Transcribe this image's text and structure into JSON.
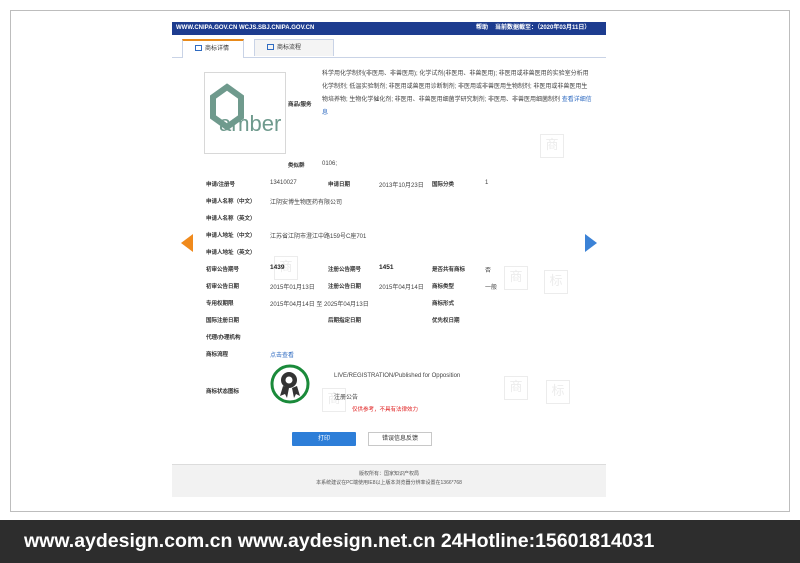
{
  "header": {
    "url": "WWW.CNIPA.GOV.CN WCJS.SBJ.CNIPA.GOV.CN",
    "help": "帮助",
    "date": "当前数据截至：（2020年03月11日）"
  },
  "tabs": [
    {
      "label": "商标详情"
    },
    {
      "label": "商标流程"
    }
  ],
  "logo": {
    "text": "amber",
    "color": "#6f9a8d"
  },
  "goods": {
    "label": "商品/服务",
    "text": "科学用化学制剂(非医用、非兽医用); 化学试剂(非医用、非兽医用); 非医用或非兽医用的实验室分析用化学制剂; 低温实验制剂; 非医用或兽医用诊断制剂; 非医用或非兽医用生物制剂; 非医用或非兽医用生物培养物; 生物化学催化剂; 非医用、非兽医用细菌学研究制剂; 非医用、非兽医用细菌制剂",
    "more": "查看详细信息"
  },
  "similar_group": {
    "label": "类似群",
    "value": "0106;"
  },
  "fields": {
    "reg_no_label": "申请/注册号",
    "reg_no": "13410027",
    "apply_date_label": "申请日期",
    "apply_date": "2013年10月23日",
    "intl_class_label": "国际分类",
    "intl_class": "1",
    "applicant_cn_label": "申请人名称（中文）",
    "applicant_cn": "江阴安博生物医药有限公司",
    "applicant_en_label": "申请人名称（英文）",
    "address_cn_label": "申请人地址（中文）",
    "address_cn": "江苏省江阴市澄江中路159号C座701",
    "address_en_label": "申请人地址（英文）",
    "pub_no_label": "初审公告期号",
    "pub_no": "1439",
    "reg_pub_no_label": "注册公告期号",
    "reg_pub_no": "1451",
    "shared_label": "是否共有商标",
    "shared": "否",
    "pub_date_label": "初审公告日期",
    "pub_date": "2015年01月13日",
    "reg_pub_date_label": "注册公告日期",
    "reg_pub_date": "2015年04月14日",
    "type_label": "商标类型",
    "type": "一般",
    "exclusive_label": "专用权期限",
    "exclusive": "2015年04月14日 至 2025年04月13日",
    "form_label": "商标形式",
    "intl_reg_date_label": "国际注册日期",
    "later_date_label": "后期指定日期",
    "priority_label": "优先权日期",
    "agent_label": "代理/办理机构",
    "flow_label": "商标流程",
    "flow_link": "点击查看",
    "status_label": "商标状态图标",
    "status_text": "LIVE/REGISTRATION/Published for Opposition",
    "status_sub": "注册公告"
  },
  "notice": "仅供参考，不具有法律效力",
  "buttons": {
    "print": "打印",
    "error": "错误信息反馈"
  },
  "footer": {
    "line1": "版权所有：国家知识产权局",
    "line2": "本系统建议在PC端使用IE8以上版本浏览器分辨率设置在1366*768"
  },
  "bottom_banner": "www.aydesign.com.cn www.aydesign.net.cn 24Hotline:15601814031",
  "colors": {
    "header": "#1d3c8f",
    "accent": "#2d7ed8",
    "badge": "#1a8a3a",
    "notice": "#e02020"
  }
}
